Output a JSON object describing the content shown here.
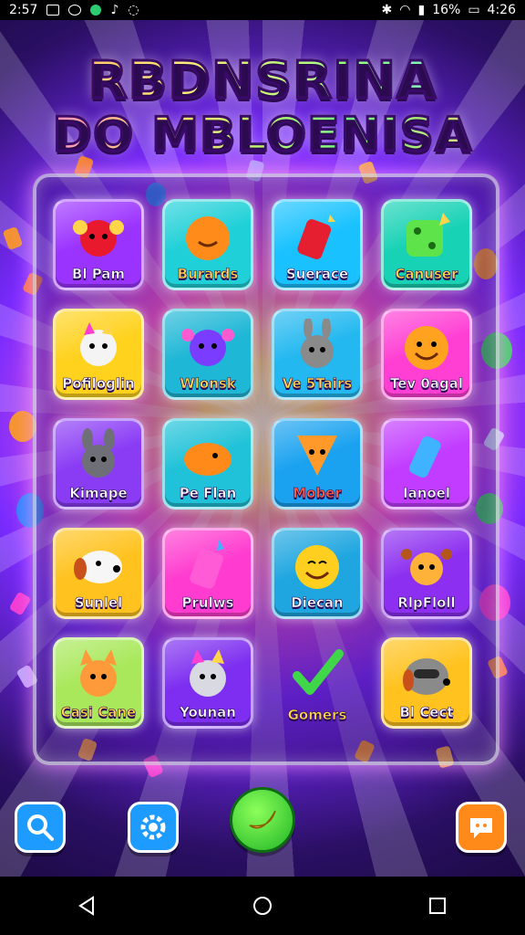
{
  "status_bar": {
    "time_left": "2:57",
    "battery": "16%",
    "time_right": "4:26"
  },
  "title": {
    "line1": "RBDNSRINA",
    "line2": "DO MBLOENISA"
  },
  "tiles": [
    {
      "label": "Bl Pam",
      "bg": "#9b33ff",
      "icon": "red-ball-character-icon",
      "color": "white"
    },
    {
      "label": "Burards",
      "bg": "#1fd0d8",
      "icon": "orange-blob-icon",
      "color": "gold"
    },
    {
      "label": "Suerace",
      "bg": "#19c2ff",
      "icon": "red-rocket-icon",
      "color": "white"
    },
    {
      "label": "Canuser",
      "bg": "#18d2b5",
      "icon": "green-dice-icon",
      "color": "gold"
    },
    {
      "label": "Pofiloglin",
      "bg": "#ffd21e",
      "icon": "white-cat-icon",
      "color": "white"
    },
    {
      "label": "Wlonsk",
      "bg": "#1fb7d6",
      "icon": "purple-axolotl-icon",
      "color": "gold"
    },
    {
      "label": "Ve 5Tairs",
      "bg": "#23b8f0",
      "icon": "grey-bunny-icon",
      "color": "gold"
    },
    {
      "label": "Tev 0agal",
      "bg": "#ff3fd4",
      "icon": "orange-smiley-icon",
      "color": "white"
    },
    {
      "label": "Kimape",
      "bg": "#8a3cf5",
      "icon": "grey-rabbit-icon",
      "color": "white"
    },
    {
      "label": "Pe Flan",
      "bg": "#1fc2d8",
      "icon": "orange-bean-icon",
      "color": "white"
    },
    {
      "label": "Mober",
      "bg": "#1aa2f0",
      "icon": "fox-icon",
      "color": "red"
    },
    {
      "label": "Ianoel",
      "bg": "#c23cff",
      "icon": "blue-crystal-icon",
      "color": "white"
    },
    {
      "label": "Sunlel",
      "bg": "#ffc21e",
      "icon": "white-puppy-icon",
      "color": "white"
    },
    {
      "label": "Prulws",
      "bg": "#ff3ccf",
      "icon": "pink-potion-icon",
      "color": "white"
    },
    {
      "label": "Diecan",
      "bg": "#1fa6e0",
      "icon": "yellow-smiley-icon",
      "color": "white"
    },
    {
      "label": "RlpFloll",
      "bg": "#8c2ff0",
      "icon": "axolotl-icon",
      "color": "white"
    },
    {
      "label": "Casi Cane",
      "bg": "#a8e85a",
      "icon": "corgi-icon",
      "color": "gold"
    },
    {
      "label": "Younan",
      "bg": "#7d2ef0",
      "icon": "rainbow-cat-icon",
      "color": "white"
    },
    {
      "label": "Gomers",
      "bg": "transparent",
      "icon": "green-checkmark-icon",
      "color": "gold"
    },
    {
      "label": "Bl Cect",
      "bg": "#ffc21e",
      "icon": "raccoon-icon",
      "color": "white"
    }
  ],
  "bottom": {
    "search_icon": "search-icon",
    "settings_icon": "gear-icon",
    "play_icon": "banana-icon",
    "chat_icon": "chat-icon"
  },
  "nav": {
    "back_icon": "back-triangle-icon",
    "home_icon": "home-circle-icon",
    "recents_icon": "recents-square-icon"
  }
}
